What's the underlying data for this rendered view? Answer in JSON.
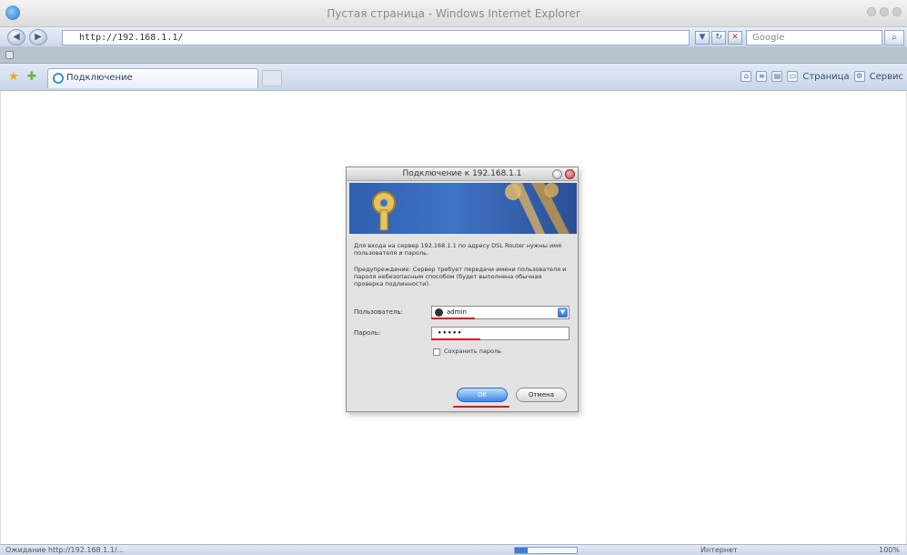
{
  "window": {
    "title": "Пустая страница - Windows Internet Explorer"
  },
  "address_bar": {
    "url": "http://192.168.1.1/",
    "search_placeholder": "Google"
  },
  "tab": {
    "label": "Подключение"
  },
  "command_bar": {
    "page_label": "Страница",
    "tools_label": "Сервис"
  },
  "dialog": {
    "title": "Подключение к 192.168.1.1",
    "message": "Для входа на сервер 192.168.1.1 по адресу DSL Router нужны имя пользователя и пароль.",
    "warning": "Предупреждение: Сервер требует передачи имени пользователя и пароля небезопасным способом (будет выполнена обычная проверка подлинности).",
    "username_label": "Пользователь:",
    "username_value": "admin",
    "password_label": "Пароль:",
    "password_value": "•••••",
    "remember_label": "Сохранить пароль",
    "remember_checked": false,
    "ok_label": "OK",
    "cancel_label": "Отмена"
  },
  "status_bar": {
    "left_text": "Ожидание http://192.168.1.1/...",
    "zone_text": "Интернет",
    "zoom_text": "100%"
  },
  "colors": {
    "highlight": "#e01010",
    "ok_button": "#3d86e6",
    "banner": "#3f73c4"
  }
}
